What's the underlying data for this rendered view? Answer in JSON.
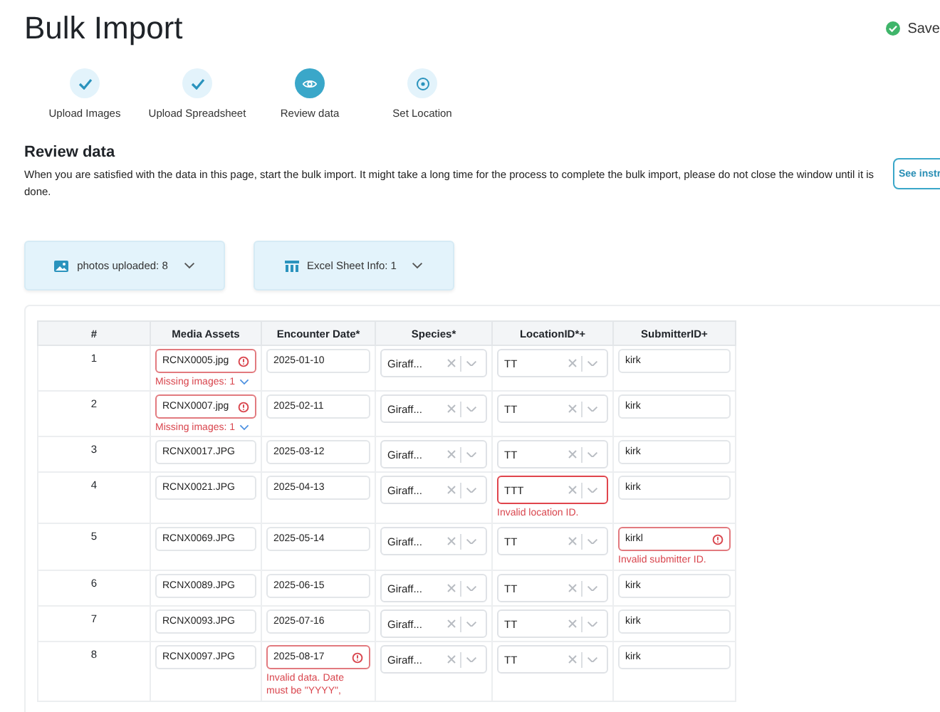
{
  "header": {
    "title": "Bulk Import",
    "save_status": "Save",
    "saved": true
  },
  "steps": [
    {
      "label": "Upload Images",
      "done": true,
      "current": false
    },
    {
      "label": "Upload Spreadsheet",
      "done": true,
      "current": false
    },
    {
      "label": "Review data",
      "done": false,
      "current": true
    },
    {
      "label": "Set Location",
      "done": false,
      "current": false
    }
  ],
  "review": {
    "heading": "Review data",
    "description": "When you are satisfied with the data in this page, start the bulk import. It might take a long time for the process to complete the bulk import, please do not close the window until it is done.",
    "instructions_button": "See instr"
  },
  "summary": [
    {
      "kind": "photos",
      "label": "photos uploaded: 8",
      "expanded": false
    },
    {
      "kind": "sheet",
      "label": "Excel Sheet Info: 1",
      "expanded": false
    }
  ],
  "table": {
    "columns": [
      "#",
      "Media Assets",
      "Encounter Date*",
      "Species*",
      "LocationID*+",
      "SubmitterID+"
    ],
    "rows": [
      {
        "number": "1",
        "media": {
          "value": "RCNX0005.jpg",
          "error": true,
          "note": "Missing images: 1"
        },
        "date": {
          "value": "2025-01-10",
          "error": false
        },
        "species": "Giraff...",
        "location": {
          "value": "TT",
          "error": false
        },
        "submitter": {
          "value": "kirk",
          "error": false
        }
      },
      {
        "number": "2",
        "media": {
          "value": "RCNX0007.jpg",
          "error": true,
          "note": "Missing images: 1"
        },
        "date": {
          "value": "2025-02-11",
          "error": false
        },
        "species": "Giraff...",
        "location": {
          "value": "TT",
          "error": false
        },
        "submitter": {
          "value": "kirk",
          "error": false
        }
      },
      {
        "number": "3",
        "media": {
          "value": "RCNX0017.JPG",
          "error": false
        },
        "date": {
          "value": "2025-03-12",
          "error": false
        },
        "species": "Giraff...",
        "location": {
          "value": "TT",
          "error": false
        },
        "submitter": {
          "value": "kirk",
          "error": false
        }
      },
      {
        "number": "4",
        "media": {
          "value": "RCNX0021.JPG",
          "error": false
        },
        "date": {
          "value": "2025-04-13",
          "error": false
        },
        "species": "Giraff...",
        "location": {
          "value": "TTT",
          "error": true,
          "note": "Invalid location ID."
        },
        "submitter": {
          "value": "kirk",
          "error": false
        }
      },
      {
        "number": "5",
        "media": {
          "value": "RCNX0069.JPG",
          "error": false
        },
        "date": {
          "value": "2025-05-14",
          "error": false
        },
        "species": "Giraff...",
        "location": {
          "value": "TT",
          "error": false
        },
        "submitter": {
          "value": "kirkl",
          "error": true,
          "note": "Invalid submitter ID."
        }
      },
      {
        "number": "6",
        "media": {
          "value": "RCNX0089.JPG",
          "error": false
        },
        "date": {
          "value": "2025-06-15",
          "error": false
        },
        "species": "Giraff...",
        "location": {
          "value": "TT",
          "error": false
        },
        "submitter": {
          "value": "kirk",
          "error": false
        }
      },
      {
        "number": "7",
        "media": {
          "value": "RCNX0093.JPG",
          "error": false
        },
        "date": {
          "value": "2025-07-16",
          "error": false
        },
        "species": "Giraff...",
        "location": {
          "value": "TT",
          "error": false
        },
        "submitter": {
          "value": "kirk",
          "error": false
        }
      },
      {
        "number": "8",
        "media": {
          "value": "RCNX0097.JPG",
          "error": false
        },
        "date": {
          "value": "2025-08-17",
          "error": true,
          "note": "Invalid data. Date must be \"YYYY\","
        },
        "species": "Giraff...",
        "location": {
          "value": "TT",
          "error": false
        },
        "submitter": {
          "value": "kirk",
          "error": false
        }
      }
    ]
  }
}
